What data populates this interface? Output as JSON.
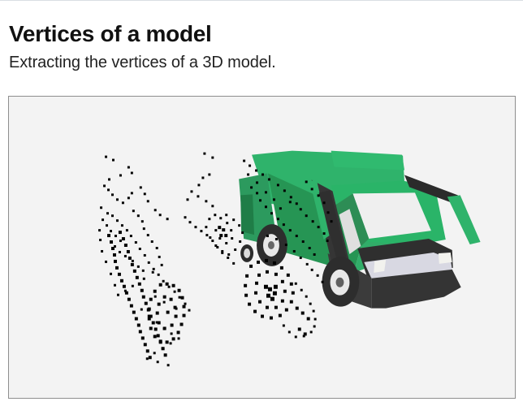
{
  "header": {
    "title": "Vertices of a model",
    "subtitle": "Extracting the vertices of a 3D model."
  },
  "viewport": {
    "background": "#f3f3f3",
    "border_color": "#8e8e8e"
  },
  "scene": {
    "truck_body_color": "#2fb36b",
    "truck_dark_color": "#2a2a2a",
    "truck_window_color": "#efefef",
    "point_color": "#000000"
  }
}
